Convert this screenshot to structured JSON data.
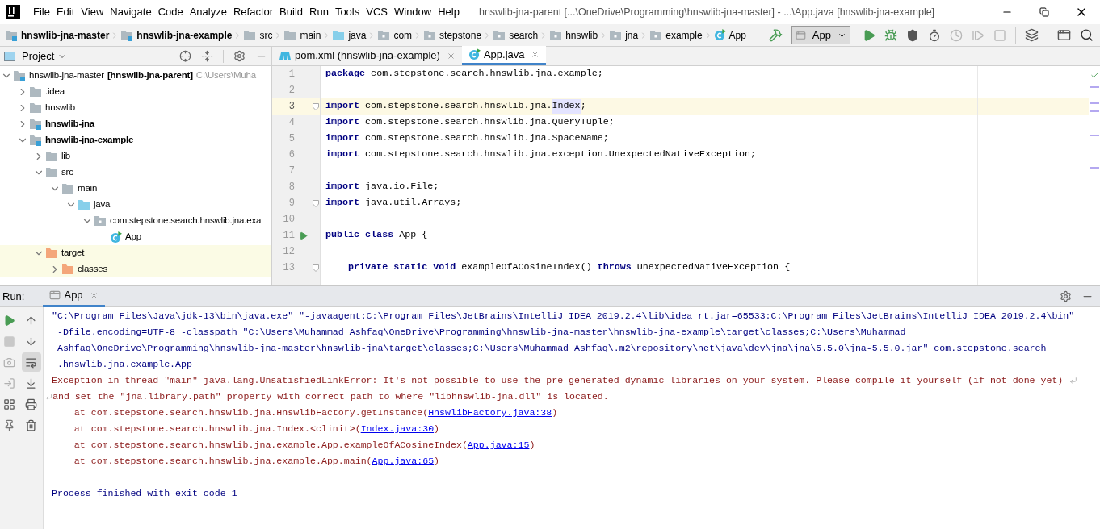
{
  "menu": [
    "File",
    "Edit",
    "View",
    "Navigate",
    "Code",
    "Analyze",
    "Refactor",
    "Build",
    "Run",
    "Tools",
    "VCS",
    "Window",
    "Help"
  ],
  "window": {
    "title": "hnswlib-jna-parent [...\\OneDrive\\Programming\\hnswlib-jna-master] - ...\\App.java [hnswlib-jna-example]"
  },
  "breadcrumbs": [
    {
      "label": "hnswlib-jna-master",
      "kind": "module"
    },
    {
      "label": "hnswlib-jna-example",
      "kind": "module"
    },
    {
      "label": "src",
      "kind": "folder"
    },
    {
      "label": "main",
      "kind": "folder"
    },
    {
      "label": "java",
      "kind": "source"
    },
    {
      "label": "com",
      "kind": "package"
    },
    {
      "label": "stepstone",
      "kind": "package"
    },
    {
      "label": "search",
      "kind": "package"
    },
    {
      "label": "hnswlib",
      "kind": "package"
    },
    {
      "label": "jna",
      "kind": "package"
    },
    {
      "label": "example",
      "kind": "package"
    },
    {
      "label": "App",
      "kind": "class"
    }
  ],
  "run_config": {
    "label": "App"
  },
  "toolbar": [
    {
      "kind": "run",
      "disabled": false
    },
    {
      "kind": "debug",
      "disabled": false
    },
    {
      "kind": "coverage",
      "disabled": false
    },
    {
      "kind": "profile",
      "disabled": false
    },
    {
      "kind": "attach",
      "disabled": true
    },
    {
      "kind": "step",
      "disabled": true
    },
    {
      "kind": "stop",
      "disabled": true
    }
  ],
  "project": {
    "title": "Project",
    "tree": [
      {
        "name": "hnswlib-jna-master",
        "module": "[hnswlib-jna-parent]",
        "hint": "C:\\Users\\Muha",
        "kind": "module",
        "expanded": true,
        "children": [
          {
            "name": ".idea",
            "kind": "folder",
            "expanded": false
          },
          {
            "name": "hnswlib",
            "kind": "folder",
            "expanded": false
          },
          {
            "name": "hnswlib-jna",
            "kind": "module",
            "expanded": false
          },
          {
            "name": "hnswlib-jna-example",
            "kind": "module",
            "expanded": true,
            "children": [
              {
                "name": "lib",
                "kind": "folder",
                "expanded": false
              },
              {
                "name": "src",
                "kind": "folder",
                "expanded": true,
                "children": [
                  {
                    "name": "main",
                    "kind": "folder",
                    "expanded": true,
                    "children": [
                      {
                        "name": "java",
                        "kind": "source",
                        "expanded": true,
                        "children": [
                          {
                            "name": "com.stepstone.search.hnswlib.jna.exa",
                            "kind": "package",
                            "expanded": true,
                            "children": [
                              {
                                "name": "App",
                                "kind": "class"
                              }
                            ]
                          }
                        ]
                      }
                    ]
                  }
                ]
              },
              {
                "name": "target",
                "kind": "excluded",
                "expanded": true,
                "children": [
                  {
                    "name": "classes",
                    "kind": "excluded",
                    "expanded": false
                  }
                ]
              }
            ]
          }
        ]
      }
    ]
  },
  "tabs": [
    {
      "label": "pom.xml (hnswlib-jna-example)",
      "kind": "maven",
      "selected": false
    },
    {
      "label": "App.java",
      "kind": "class",
      "selected": true
    }
  ],
  "editor": {
    "lines": [
      {
        "number": "1",
        "tokens": [
          {
            "text": "package",
            "kind": "keyword"
          },
          {
            "text": " com.stepstone.search.hnswlib.jna.example;",
            "kind": "plain"
          }
        ]
      },
      {
        "number": "2"
      },
      {
        "number": "3",
        "current": true,
        "fold": true,
        "tokens": [
          {
            "text": "import",
            "kind": "keyword"
          },
          {
            "text": " com.stepstone.search.hnswlib.jna.",
            "kind": "plain"
          },
          {
            "text": "Index",
            "kind": "highlight"
          },
          {
            "text": ";",
            "kind": "plain"
          }
        ]
      },
      {
        "number": "4",
        "tokens": [
          {
            "text": "import",
            "kind": "keyword"
          },
          {
            "text": " com.stepstone.search.hnswlib.jna.QueryTuple;",
            "kind": "plain"
          }
        ]
      },
      {
        "number": "5",
        "tokens": [
          {
            "text": "import",
            "kind": "keyword"
          },
          {
            "text": " com.stepstone.search.hnswlib.jna.SpaceName;",
            "kind": "plain"
          }
        ]
      },
      {
        "number": "6",
        "tokens": [
          {
            "text": "import",
            "kind": "keyword"
          },
          {
            "text": " com.stepstone.search.hnswlib.jna.exception.UnexpectedNativeException;",
            "kind": "plain"
          }
        ]
      },
      {
        "number": "7"
      },
      {
        "number": "8",
        "tokens": [
          {
            "text": "import",
            "kind": "keyword"
          },
          {
            "text": " java.io.File;",
            "kind": "plain"
          }
        ]
      },
      {
        "number": "9",
        "fold": true,
        "tokens": [
          {
            "text": "import",
            "kind": "keyword"
          },
          {
            "text": " java.util.Arrays;",
            "kind": "plain"
          }
        ]
      },
      {
        "number": "10"
      },
      {
        "number": "11",
        "runnable": true,
        "tokens": [
          {
            "text": "public class",
            "kind": "keyword"
          },
          {
            "text": " App {",
            "kind": "plain"
          }
        ]
      },
      {
        "number": "12"
      },
      {
        "number": "13",
        "fold": true,
        "tokens": [
          {
            "text": "    private static void",
            "kind": "keyword"
          },
          {
            "text": " exampleOfACosineIndex() ",
            "kind": "plain"
          },
          {
            "text": "throws",
            "kind": "keyword"
          },
          {
            "text": " UnexpectedNativeException {",
            "kind": "plain"
          }
        ]
      }
    ]
  },
  "run": {
    "label": "Run:",
    "tab": "App",
    "wrap_selected": true,
    "output": [
      {
        "kind": "command",
        "text": "\"C:\\Program Files\\Java\\jdk-13\\bin\\java.exe\" \"-javaagent:C:\\Program Files\\JetBrains\\IntelliJ IDEA 2019.2.4\\lib\\idea_rt.jar=65533:C:\\Program Files\\JetBrains\\IntelliJ IDEA 2019.2.4\\bin\""
      },
      {
        "kind": "command",
        "text": " -Dfile.encoding=UTF-8 -classpath \"C:\\Users\\Muhammad Ashfaq\\OneDrive\\Programming\\hnswlib-jna-master\\hnswlib-jna-example\\target\\classes;C:\\Users\\Muhammad"
      },
      {
        "kind": "command",
        "text": " Ashfaq\\OneDrive\\Programming\\hnswlib-jna-master\\hnswlib-jna\\target\\classes;C:\\Users\\Muhammad Ashfaq\\.m2\\repository\\net\\java\\dev\\jna\\jna\\5.5.0\\jna-5.5.0.jar\" com.stepstone.search"
      },
      {
        "kind": "command",
        "text": " .hnswlib.jna.example.App"
      },
      {
        "kind": "error",
        "wrap_end": true,
        "text": "Exception in thread \"main\" java.lang.UnsatisfiedLinkError: It's not possible to use the pre-generated dynamic libraries on your system. Please compile it yourself (if not done yet)"
      },
      {
        "kind": "error",
        "wrap_start": true,
        "text": "and set the \"jna.library.path\" property with correct path to where \"libhnswlib-jna.dll\" is located."
      },
      {
        "kind": "trace",
        "text": "    at com.stepstone.search.hnswlib.jna.HnswlibFactory.getInstance(",
        "link": "HnswlibFactory.java:38",
        "suffix": ")"
      },
      {
        "kind": "trace",
        "text": "    at com.stepstone.search.hnswlib.jna.Index.<clinit>(",
        "link": "Index.java:30",
        "suffix": ")"
      },
      {
        "kind": "trace",
        "text": "    at com.stepstone.search.hnswlib.jna.example.App.exampleOfACosineIndex(",
        "link": "App.java:15",
        "suffix": ")"
      },
      {
        "kind": "trace",
        "text": "    at com.stepstone.search.hnswlib.jna.example.App.main(",
        "link": "App.java:65",
        "suffix": ")"
      },
      {
        "kind": "blank"
      },
      {
        "kind": "command",
        "text": "Process finished with exit code 1"
      }
    ]
  }
}
